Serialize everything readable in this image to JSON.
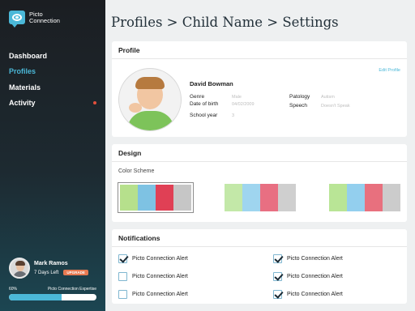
{
  "app": {
    "logo_line1": "Picto",
    "logo_line2": "Connection"
  },
  "nav": [
    {
      "label": "Dashboard"
    },
    {
      "label": "Profiles"
    },
    {
      "label": "Materials"
    },
    {
      "label": "Activity"
    }
  ],
  "user": {
    "name": "Mark Ramos",
    "days_left": "7 Days Left",
    "upgrade_label": "UPGRADE"
  },
  "progress": {
    "percent_label": "60%",
    "name": "Picto Connection Expertise",
    "value": 0.6
  },
  "breadcrumb": "Profiles > Child Name > Settings",
  "profile": {
    "header": "Profile",
    "edit_label": "Edit Profile",
    "name": "David Bowman",
    "genre_label": "Genre",
    "genre_value": "Male",
    "dob_label": "Date of birth",
    "dob_value": "04/02/2009",
    "school_label": "School year",
    "school_value": "3",
    "patology_label": "Patology",
    "patology_value": "Autism",
    "speech_label": "Speech",
    "speech_value": "Doesn't Speak"
  },
  "design": {
    "header": "Design",
    "color_scheme_label": "Color Scheme",
    "schemes": [
      {
        "colors": [
          "#b6e08c",
          "#7ec2e3",
          "#e04055",
          "#c6c6c6"
        ],
        "selected": true
      },
      {
        "colors": [
          "#c3e8a8",
          "#9fd5ef",
          "#e86f82",
          "#cfcfcf"
        ],
        "selected": false
      },
      {
        "colors": [
          "#b9e596",
          "#93cfee",
          "#e8707e",
          "#cccccc"
        ],
        "selected": false
      }
    ]
  },
  "notifications": {
    "header": "Notifications",
    "items": [
      {
        "label": "Picto Connection Alert",
        "checked": true
      },
      {
        "label": "Picto Connection Alert",
        "checked": false
      },
      {
        "label": "Picto Connection Alert",
        "checked": false
      },
      {
        "label": "Picto Connection Alert",
        "checked": true
      },
      {
        "label": "Picto Connection Alert",
        "checked": true
      },
      {
        "label": "Picto Connection Alert",
        "checked": true
      }
    ]
  },
  "colors": {
    "accent": "#4bb8d8",
    "alert_dot": "#e2503d",
    "upgrade": "#e77a52"
  }
}
